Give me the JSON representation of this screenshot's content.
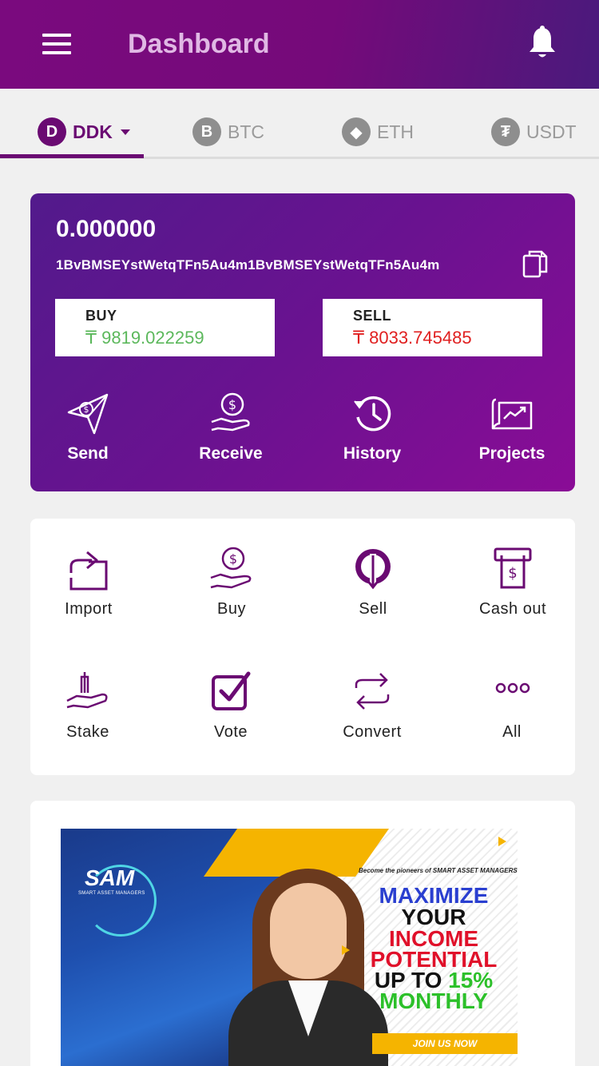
{
  "header": {
    "title": "Dashboard",
    "menu_icon": "hamburger-menu-icon",
    "notification_icon": "bell-icon"
  },
  "tabs": [
    {
      "label": "DDK",
      "coin": "D",
      "active": true
    },
    {
      "label": "BTC",
      "coin": "B",
      "active": false
    },
    {
      "label": "ETH",
      "coin": "◆",
      "active": false
    },
    {
      "label": "USDT",
      "coin": "₮",
      "active": false
    }
  ],
  "wallet": {
    "balance": "0.000000",
    "address": "1BvBMSEYstWetqTFn5Au4m1BvBMSEYstWetqTFn5Au4m",
    "buy_label": "BUY",
    "buy_value": "₸ 9819.022259",
    "sell_label": "SELL",
    "sell_value": "₸ 8033.745485",
    "actions": [
      {
        "label": "Send",
        "icon": "send-money-icon"
      },
      {
        "label": "Receive",
        "icon": "receive-money-icon"
      },
      {
        "label": "History",
        "icon": "history-icon"
      },
      {
        "label": "Projects",
        "icon": "projects-chart-icon"
      }
    ]
  },
  "services": [
    {
      "label": "Import",
      "icon": "import-icon"
    },
    {
      "label": "Buy",
      "icon": "buy-icon"
    },
    {
      "label": "Sell",
      "icon": "sell-icon"
    },
    {
      "label": "Cash out",
      "icon": "cash-out-icon"
    },
    {
      "label": "Stake",
      "icon": "stake-icon"
    },
    {
      "label": "Vote",
      "icon": "vote-icon"
    },
    {
      "label": "Convert",
      "icon": "convert-icon"
    },
    {
      "label": "All",
      "icon": "more-dots-icon"
    }
  ],
  "banner": {
    "logo": "SAM",
    "logo_sub": "SMART ASSET MANAGERS",
    "tagline": "Become the pioneers of SMART ASSET MANAGERS",
    "line1": "MAXIMIZE",
    "line2": "YOUR",
    "line3": "INCOME",
    "line4": "POTENTIAL",
    "line5_a": "UP TO ",
    "line5_b": "15%",
    "line6": "MONTHLY",
    "cta": "JOIN US NOW"
  },
  "colors": {
    "brand_purple": "#6a0a72",
    "buy_green": "#5cb85c",
    "sell_red": "#e02020"
  }
}
